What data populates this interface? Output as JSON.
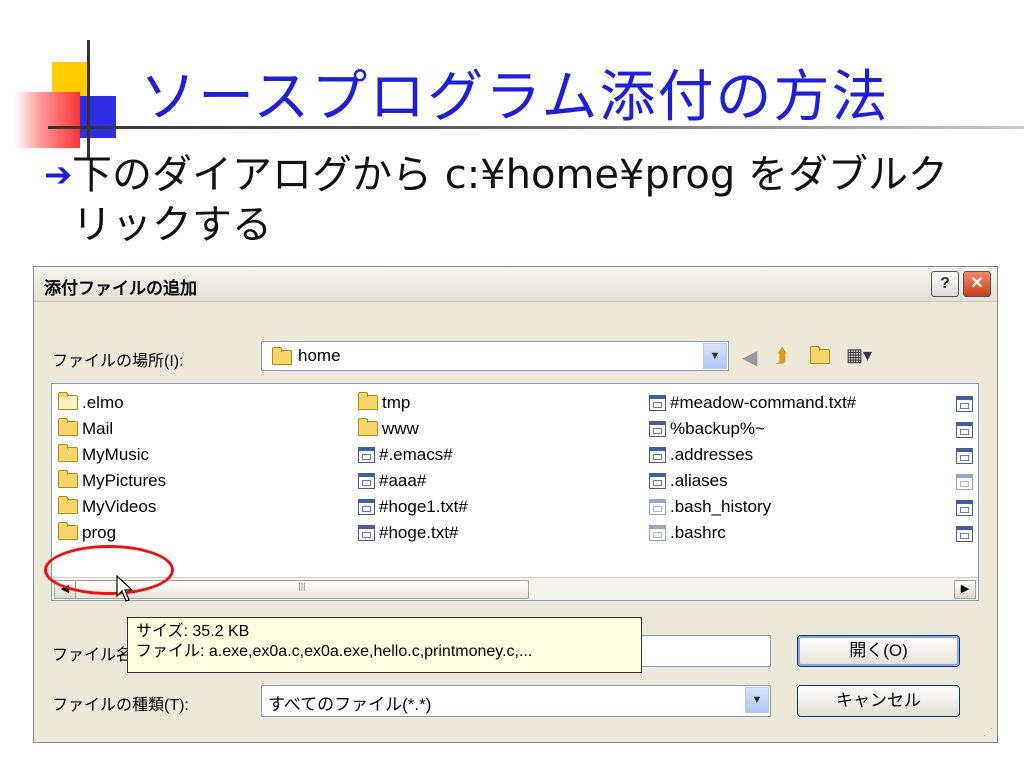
{
  "slide": {
    "title": "ソースプログラム添付の方法",
    "instruction_line1": "下のダイアログから c:¥home¥prog をダブルク",
    "instruction_line2": "リックする",
    "arrow_glyph": "➔"
  },
  "dialog": {
    "title": "添付ファイルの追加",
    "help_label": "?",
    "close_label": "✕",
    "location_label": "ファイルの場所(I):",
    "location_value": "home",
    "file_name_label": "ファイル名",
    "file_type_label": "ファイルの種類(T):",
    "file_type_value": "すべてのファイル(*.*)",
    "open_button": "開く(O)",
    "cancel_button": "キャンセル",
    "toolbar_icons": [
      "back-icon",
      "up-folder-icon",
      "new-folder-icon",
      "view-menu-icon"
    ],
    "files": {
      "col1": [
        ".elmo",
        "Mail",
        "MyMusic",
        "MyPictures",
        "MyVideos",
        "prog"
      ],
      "col2": [
        "tmp",
        "www",
        "#.emacs#",
        "#aaa#",
        "#hoge1.txt#",
        "#hoge.txt#"
      ],
      "col3": [
        "#meadow-command.txt#",
        "%backup%~",
        ".addresses",
        ".aliases",
        ".bash_history",
        ".bashrc"
      ]
    },
    "tooltip": {
      "size_line": "サイズ: 35.2 KB",
      "files_line": "ファイル: a.exe,ex0a.c,ex0a.exe,hello.c,printmoney.c,..."
    }
  },
  "colors": {
    "accent": "#1f1fd6",
    "highlight": "#ee1111"
  }
}
